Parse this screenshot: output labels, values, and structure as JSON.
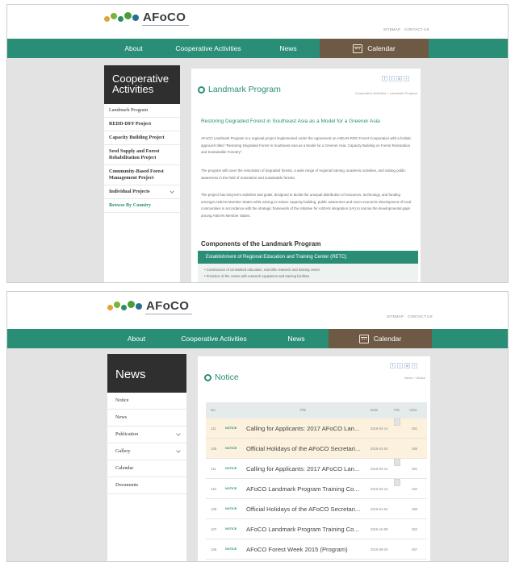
{
  "site": {
    "logo_text": "AFoCO",
    "utility_links": [
      "SITEMAP",
      "CONTACT US"
    ],
    "colors": {
      "nav": "#2a8e77",
      "calendar": "#6e5a44",
      "sidebar_header": "#2f2f2f",
      "accent": "#2a8e77",
      "highlight_row": "#fbf1dd"
    }
  },
  "nav": {
    "items": [
      "About",
      "Cooperative Activities",
      "News",
      "Calendar"
    ],
    "calendar_icon": "calendar-icon"
  },
  "page1": {
    "sidebar": {
      "title_line1": "Cooperative",
      "title_line2": "Activities",
      "items": [
        "Landmark Program",
        "REDD-DFF Project",
        "Capacity Building Project",
        "Seed Supply and Forest Rehabilitation Project",
        "Community-Based Forest Management Project",
        "Individual Projects",
        "Browse By Country"
      ]
    },
    "title": "Landmark Program",
    "social": [
      "f",
      "t",
      "in",
      "+"
    ],
    "breadcrumb": "Cooperative Activities > Landmark Program",
    "headline": "Restoring Degraded Forest in Southeast Asia as a Model for a Greener Asia",
    "paragraphs": [
      "AFoCO Landmark Program is a regional project implemented under the Agreement on ASEAN-ROK Forest Cooperation with a holistic approach titled \"Restoring Degraded Forest in Southeast Asia as a Model for a Greener Asia: Capacity Building on Forest Restoration and Sustainable Forestry\".",
      "The program will cover the restoration of degraded forests, a wide range of regional training, academic activities, and raising public awareness in the field of restoration and sustainable forests.",
      "The project has long-term activities and goals, designed to tackle the unequal distribution of resources, technology, and funding amongst ASEAN Member States while aiming to reduce capacity building, public awareness and socio-economic development of local communities in accordance with the strategic framework of the initiative for ASEAN integration (IAI) to narrow the developmental gaps among ASEAN Member States."
    ],
    "section_title": "Components of the Landmark Program",
    "section_bar": "Establishment of Regional Education and Training Center (RETC)",
    "bullets": [
      "Construction of centralized education, scientific research and training center",
      "Provision of the center with research equipment and training facilities"
    ]
  },
  "page2": {
    "sidebar": {
      "title": "News",
      "items": [
        "Notice",
        "News",
        "Publication",
        "Gallery",
        "Calendar",
        "Documents"
      ]
    },
    "title": "Notice",
    "social": [
      "f",
      "t",
      "in",
      "+"
    ],
    "breadcrumb": "News > Notice",
    "table": {
      "headers": [
        "No.",
        "Title",
        "Date",
        "File",
        "View"
      ],
      "rows": [
        {
          "no": "111",
          "badge": "NOTICE",
          "title": "Calling for Applicants: 2017 AFoCO Lan...",
          "date": "2016-02-14",
          "file": true,
          "views": "281",
          "highlight": true
        },
        {
          "no": "109",
          "badge": "NOTICE",
          "title": "Official Holidays of the AFoCO Secretari...",
          "date": "2016-01-04",
          "file": false,
          "views": "285",
          "highlight": true
        },
        {
          "no": "111",
          "badge": "NOTICE",
          "title": "Calling for Applicants: 2017 AFoCO Lan...",
          "date": "2016-02-14",
          "file": true,
          "views": "281",
          "highlight": false
        },
        {
          "no": "110",
          "badge": "NOTICE",
          "title": "AFoCO Landmark Program Training Co...",
          "date": "2016-02-12",
          "file": true,
          "views": "184",
          "highlight": false
        },
        {
          "no": "109",
          "badge": "NOTICE",
          "title": "Official Holidays of the AFoCO Secretari...",
          "date": "2016-01-04",
          "file": false,
          "views": "285",
          "highlight": false
        },
        {
          "no": "107",
          "badge": "NOTICE",
          "title": "AFoCO Landmark Program Training Co...",
          "date": "2015-10-08",
          "file": false,
          "views": "352",
          "highlight": false
        },
        {
          "no": "106",
          "badge": "NOTICE",
          "title": "AFoCO Forest Week 2015 (Program)",
          "date": "2015-09-25",
          "file": false,
          "views": "467",
          "highlight": false
        }
      ]
    }
  }
}
